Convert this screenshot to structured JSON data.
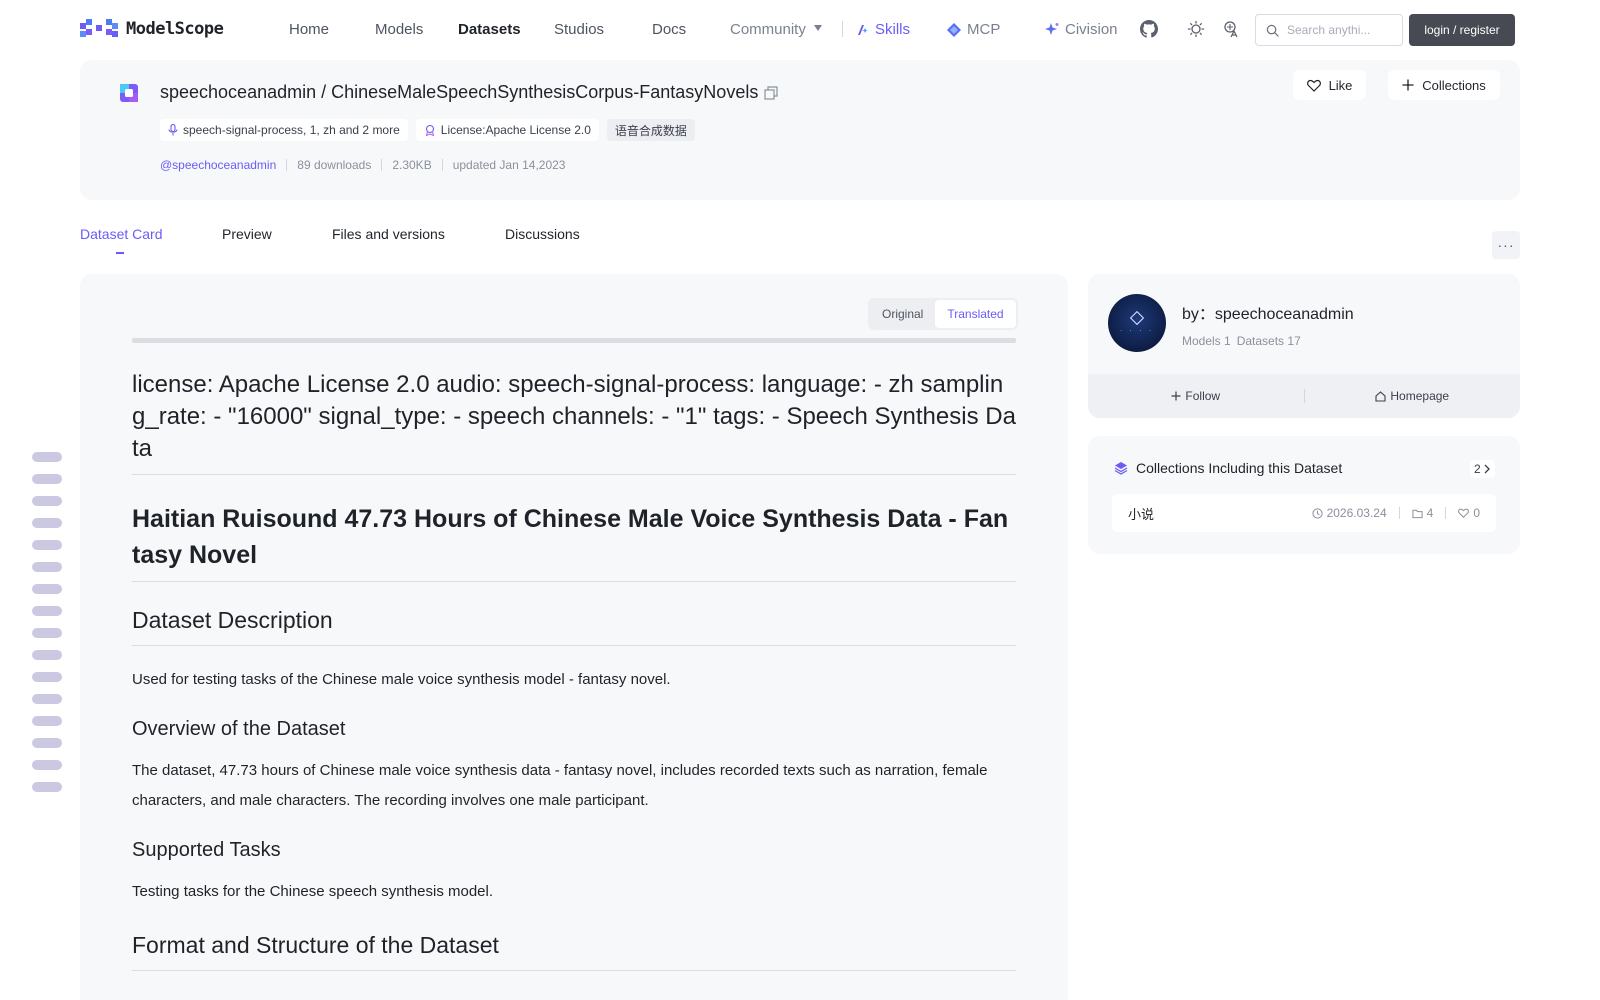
{
  "nav": {
    "logo_text": "ModelScope",
    "items": [
      "Home",
      "Models",
      "Datasets",
      "Studios",
      "Docs"
    ],
    "community_label": "Community",
    "skills_label": "Skills",
    "mcp_label": "MCP",
    "civision_label": "Civision",
    "search_placeholder": "Search anythi...",
    "login_label": "login / register"
  },
  "dataset": {
    "title": "speechoceanadmin / ChineseMaleSpeechSynthesisCorpus-FantasyNovels",
    "tags": [
      "speech-signal-process, 1, zh and 2 more",
      "License:Apache License 2.0",
      "语音合成数据"
    ],
    "author": "@speechoceanadmin",
    "downloads": "89 downloads",
    "size": "2.30KB",
    "updated": "updated Jan 14,2023",
    "like_label": "Like",
    "collections_label": "Collections"
  },
  "tabs": [
    "Dataset Card",
    "Preview",
    "Files and versions",
    "Discussions"
  ],
  "toggle": {
    "original": "Original",
    "translated": "Translated"
  },
  "card": {
    "yaml": "license: Apache License 2.0 audio: speech-signal-process: language: - zh sampling_rate: - \"16000\" signal_type: - speech channels: - \"1\" tags: - Speech Synthesis Data",
    "h1": "Haitian Ruisound 47.73 Hours of Chinese Male Voice Synthesis Data - Fantasy Novel",
    "h2_description": "Dataset Description",
    "p_description": "Used for testing tasks of the Chinese male voice synthesis model - fantasy novel.",
    "h3_overview": "Overview of the Dataset",
    "p_overview": "The dataset, 47.73 hours of Chinese male voice synthesis data - fantasy novel, includes recorded texts such as narration, female characters, and male characters. The recording involves one male participant.",
    "h3_tasks": "Supported Tasks",
    "p_tasks": "Testing tasks for the Chinese speech synthesis model.",
    "h2_format": "Format and Structure of the Dataset"
  },
  "author_card": {
    "by": "by：speechoceanadmin",
    "models": "Models 1",
    "datasets": "Datasets 17",
    "follow_label": "Follow",
    "homepage_label": "Homepage"
  },
  "collections": {
    "heading": "Collections Including this Dataset",
    "count": "2",
    "items": [
      {
        "name": "小说",
        "date": "2026.03.24",
        "datasets": "4",
        "likes": "0"
      }
    ]
  },
  "colors": {
    "accent": "#6b5cf6",
    "card_bg": "#f7f8fa",
    "login_bg": "#474a53"
  },
  "icons": [
    "logo-mark",
    "github-icon",
    "theme-sun-icon",
    "translate-icon",
    "search-icon",
    "copy-icon",
    "heart-icon",
    "plus-icon",
    "dataset-icon",
    "mic-icon",
    "license-icon",
    "layers-icon",
    "clock-icon",
    "folder-icon",
    "chevron-right-icon",
    "home-icon",
    "more-icon"
  ]
}
